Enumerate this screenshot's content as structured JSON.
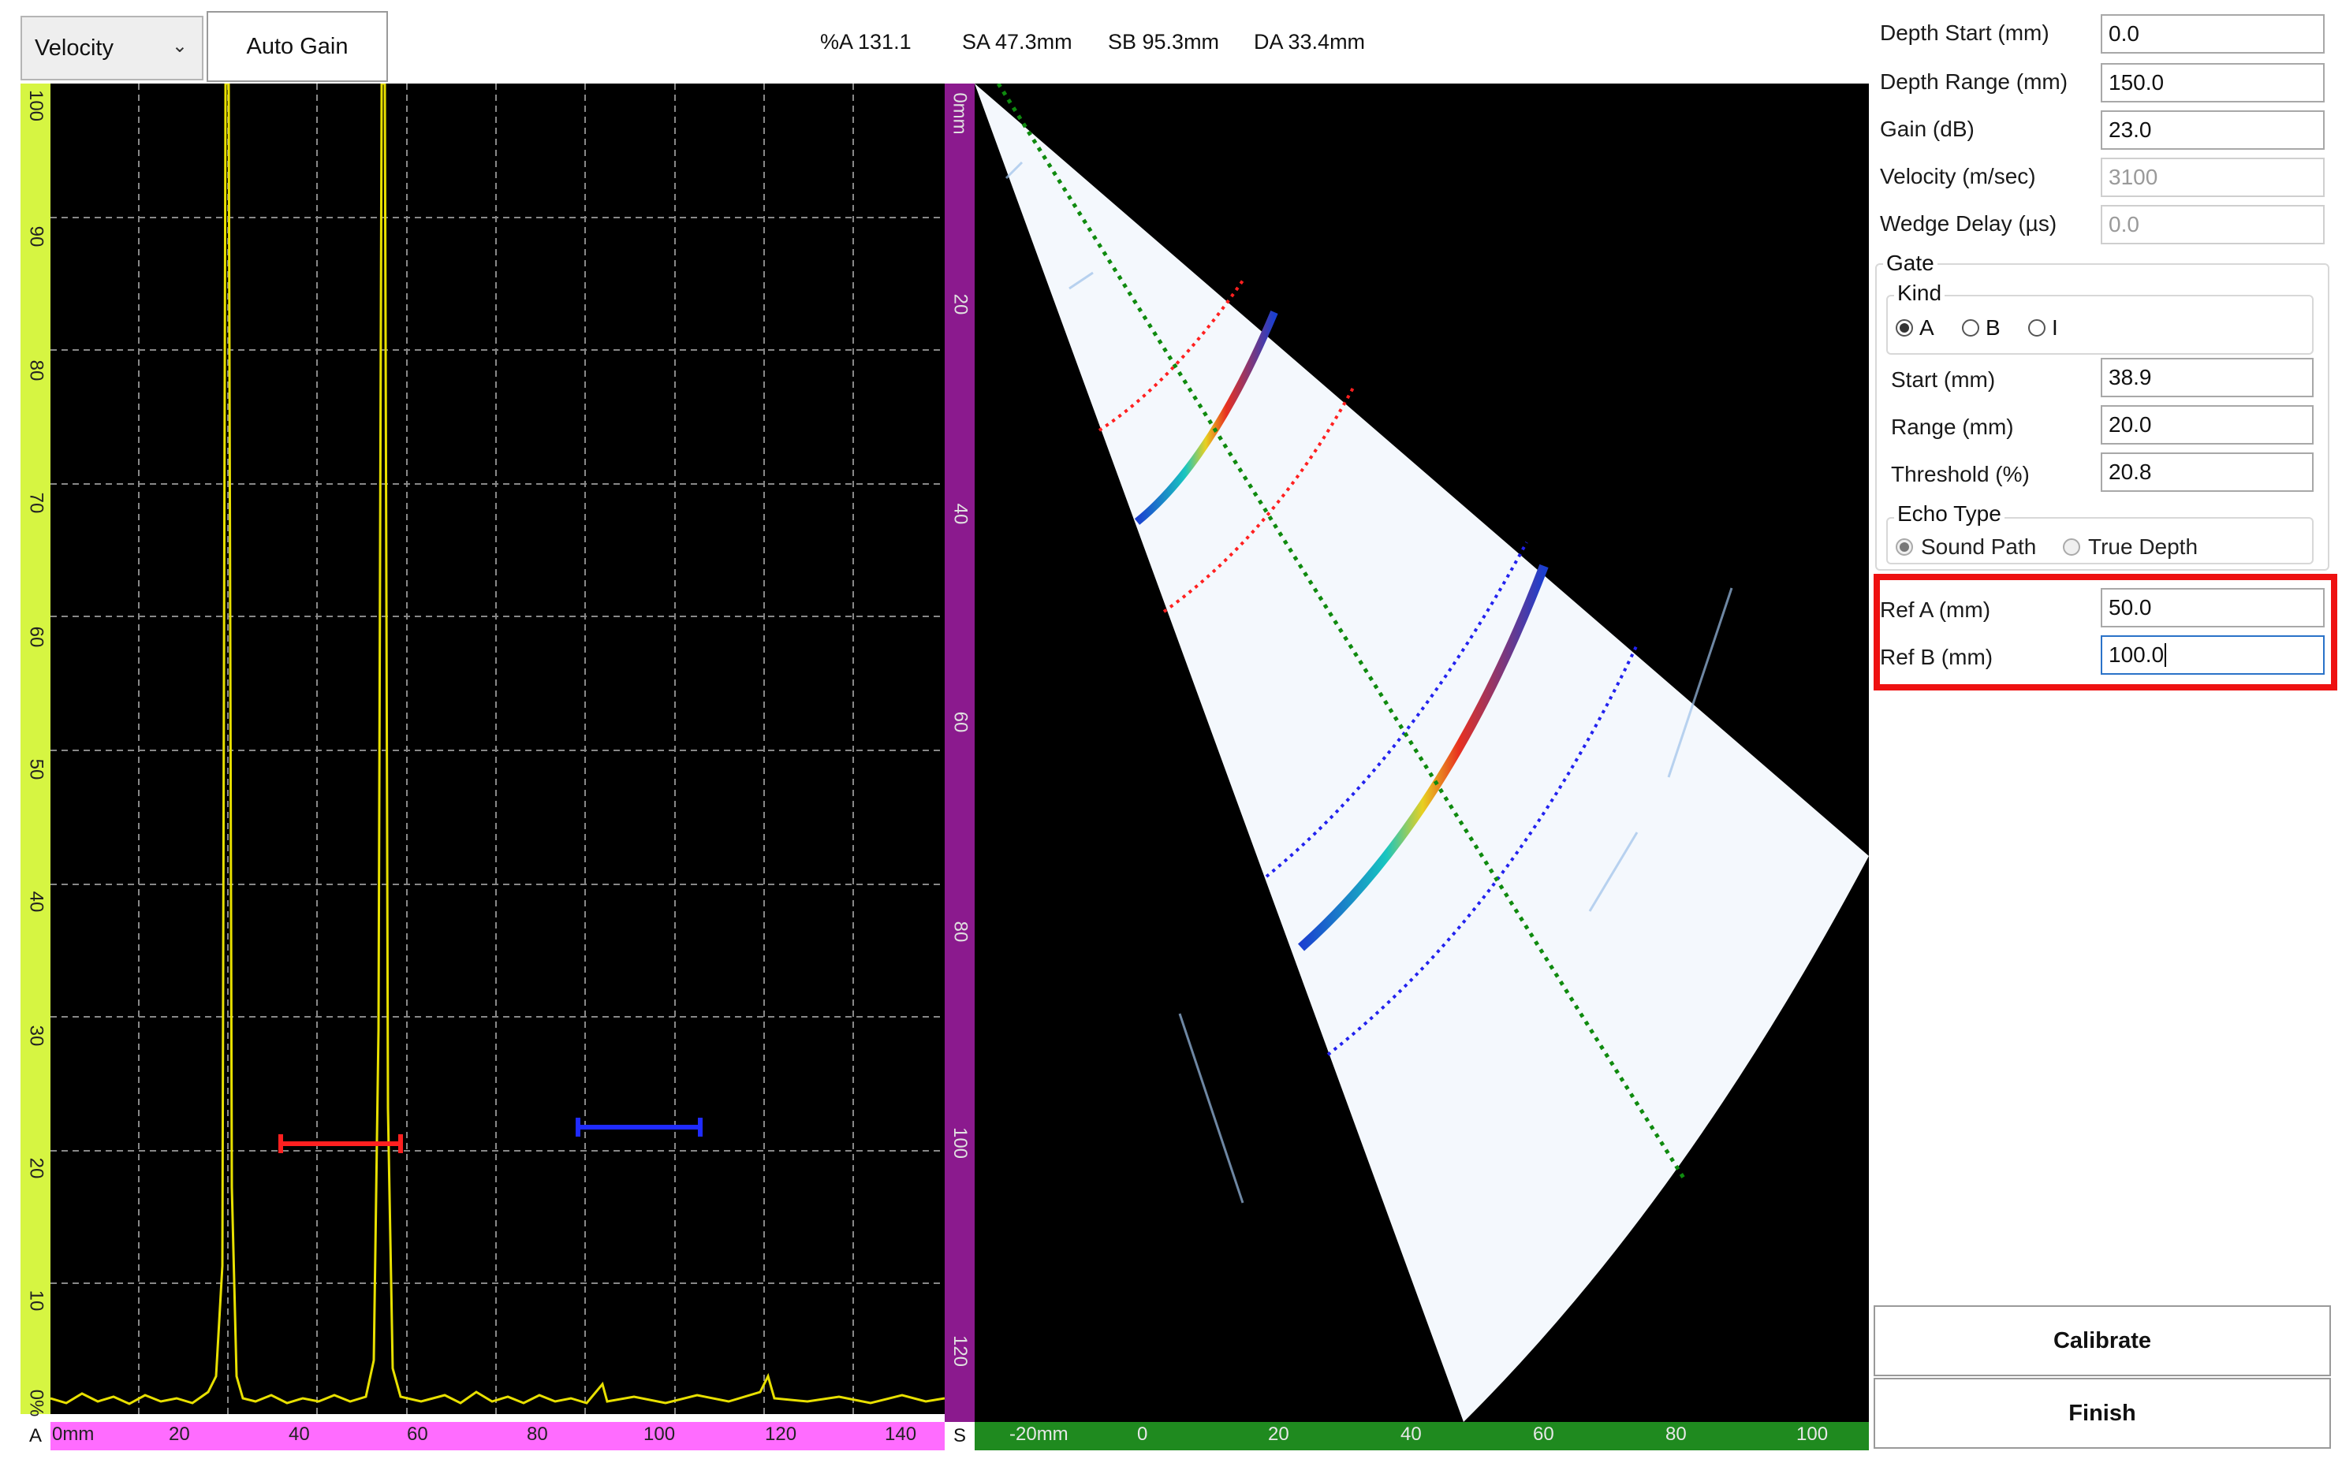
{
  "toolbar": {
    "mode_select": "Velocity",
    "auto_gain_label": "Auto Gain",
    "readouts": [
      "%A 131.1",
      "SA 47.3mm",
      "SB 95.3mm",
      "DA 33.4mm"
    ]
  },
  "ascan": {
    "amplitude_ticks": [
      "100",
      "90",
      "80",
      "70",
      "60",
      "50",
      "40",
      "30",
      "20",
      "10",
      "0%"
    ],
    "bottom_ticks": [
      "0mm",
      "20",
      "40",
      "60",
      "80",
      "100",
      "120",
      "140"
    ],
    "corner_label": "A",
    "gate_a_color": "#ff2020",
    "gate_b_color": "#1f2bff",
    "signal_color": "#e8e000"
  },
  "sscan": {
    "depth_ticks": [
      "0mm",
      "20",
      "40",
      "60",
      "80",
      "100",
      "120"
    ],
    "bottom_ticks": [
      "-20mm",
      "0",
      "20",
      "40",
      "60",
      "80",
      "100"
    ],
    "corner_label": "S",
    "cursor_colors": {
      "center": "#0f8a0f",
      "ref_a": "#ff2020",
      "ref_b": "#2222ee"
    }
  },
  "settings": {
    "depth_start": {
      "label": "Depth Start (mm)",
      "value": "0.0"
    },
    "depth_range": {
      "label": "Depth Range (mm)",
      "value": "150.0"
    },
    "gain": {
      "label": "Gain (dB)",
      "value": "23.0"
    },
    "velocity": {
      "label": "Velocity (m/sec)",
      "value": "3100"
    },
    "wedge_delay": {
      "label": "Wedge Delay (µs)",
      "value": "0.0"
    }
  },
  "gate": {
    "title": "Gate",
    "kind_title": "Kind",
    "kind_options": [
      "A",
      "B",
      "I"
    ],
    "kind_selected": "A",
    "start": {
      "label": "Start (mm)",
      "value": "38.9"
    },
    "range": {
      "label": "Range (mm)",
      "value": "20.0"
    },
    "threshold": {
      "label": "Threshold (%)",
      "value": "20.8"
    },
    "echo_type_title": "Echo Type",
    "echo_options": [
      "Sound Path",
      "True Depth"
    ],
    "echo_selected": "Sound Path"
  },
  "reference": {
    "ref_a": {
      "label": "Ref A (mm)",
      "value": "50.0"
    },
    "ref_b": {
      "label": "Ref B (mm)",
      "value": "100.0"
    },
    "highlight_color": "#ee1111"
  },
  "actions": {
    "calibrate_label": "Calibrate",
    "finish_label": "Finish"
  }
}
